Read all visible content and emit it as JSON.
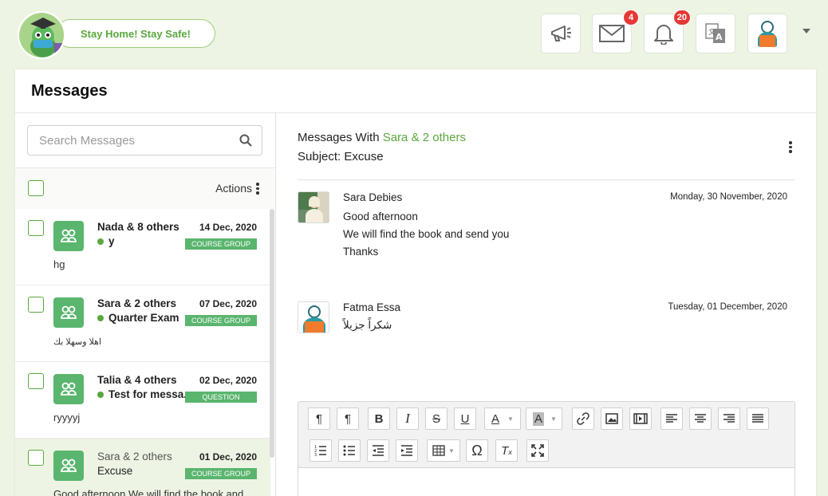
{
  "header": {
    "pill_text": "Stay Home! Stay Safe!",
    "buttons": [
      {
        "name": "announcements-button",
        "icon": "megaphone-icon",
        "badge": null
      },
      {
        "name": "messages-button",
        "icon": "envelope-icon",
        "badge": "4"
      },
      {
        "name": "notifications-button",
        "icon": "bell-icon",
        "badge": "20"
      },
      {
        "name": "language-button",
        "icon": "translate-icon",
        "badge": null
      },
      {
        "name": "profile-button",
        "icon": "user-avatar-icon",
        "badge": null
      }
    ]
  },
  "page": {
    "title": "Messages"
  },
  "sidebar": {
    "search_placeholder": "Search Messages",
    "actions_label": "Actions",
    "items": [
      {
        "name": "Nada & 8 others",
        "date": "14 Dec, 2020",
        "subject": "y",
        "tag": "COURSE GROUP",
        "preview": "hg",
        "read": false
      },
      {
        "name": "Sara & 2 others",
        "date": "07 Dec, 2020",
        "subject": "Quarter Exam",
        "tag": "COURSE GROUP",
        "preview": "اهلا وسهلا بك",
        "read": false
      },
      {
        "name": "Talia & 4 others",
        "date": "02 Dec, 2020",
        "subject": "Test for messa..",
        "tag": "QUESTION",
        "preview": "ryyyyj",
        "read": false
      },
      {
        "name": "Sara & 2 others",
        "date": "01 Dec, 2020",
        "subject": "Excuse",
        "tag": "COURSE GROUP",
        "preview": "Good afternoon We will find the book and",
        "read": true
      }
    ]
  },
  "conversation": {
    "with_prefix": "Messages With",
    "with_names": "Sara & 2 others",
    "subject": "Subject: Excuse",
    "messages": [
      {
        "from": "Sara Debies",
        "date": "Monday, 30 November, 2020",
        "lines": [
          "Good afternoon",
          "We will find the book and send you",
          "Thanks"
        ]
      },
      {
        "from": "Fatma Essa",
        "date": "Tuesday, 01 December, 2020",
        "lines": [
          "شكراً جزيلاً"
        ]
      }
    ]
  },
  "editor": {
    "toolbar_row1": [
      "¶◂",
      "¶",
      "B",
      "I",
      "S",
      "U",
      "A",
      "A",
      "link",
      "image",
      "video",
      "left",
      "center",
      "right",
      "justify"
    ],
    "toolbar_row2": [
      "ol",
      "ul",
      "outdent",
      "indent",
      "table",
      "Ω",
      "Tx",
      "fullscreen"
    ]
  },
  "colors": {
    "accent": "#5aa83e",
    "tag": "#5ab56e",
    "badge": "#e53935",
    "background": "#eef4e3"
  }
}
